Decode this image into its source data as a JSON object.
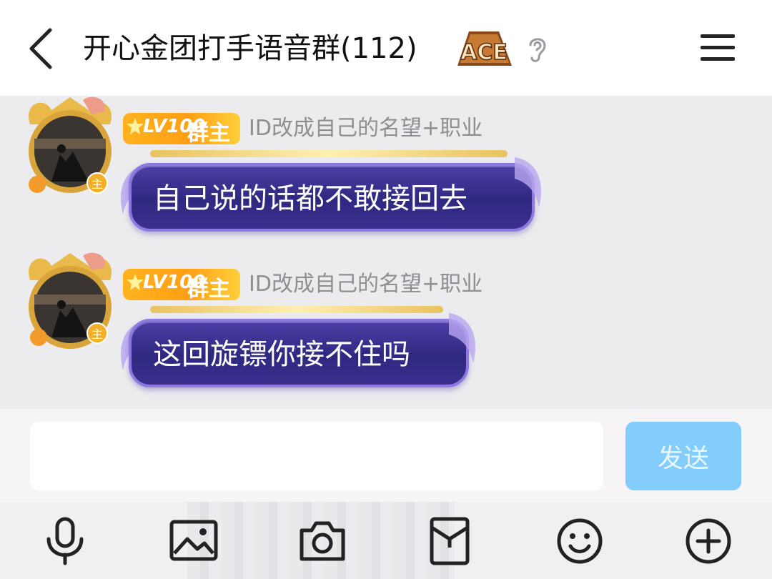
{
  "header": {
    "title": "开心金团打手语音群(112)",
    "badge_text": "ACE"
  },
  "messages": [
    {
      "level": "LV100",
      "role": "群主",
      "nickname": "ID改成自己的名望+职业",
      "text": "自己说的话都不敢接回去"
    },
    {
      "level": "LV100",
      "role": "群主",
      "nickname": "ID改成自己的名望+职业",
      "text": "这回旋镖你接不住吗"
    }
  ],
  "avatar_mark": "主",
  "input": {
    "value": "",
    "placeholder": ""
  },
  "send_label": "发送",
  "toolbar": {
    "icons": [
      "microphone-icon",
      "image-icon",
      "camera-icon",
      "red-packet-icon",
      "emoji-icon",
      "plus-icon"
    ]
  },
  "colors": {
    "bubble": "#2f2880",
    "bubble_border": "#8d7ae0",
    "level_badge": "#ffa81a",
    "send_button": "#82cdfb",
    "nickname": "#8e8e93"
  }
}
